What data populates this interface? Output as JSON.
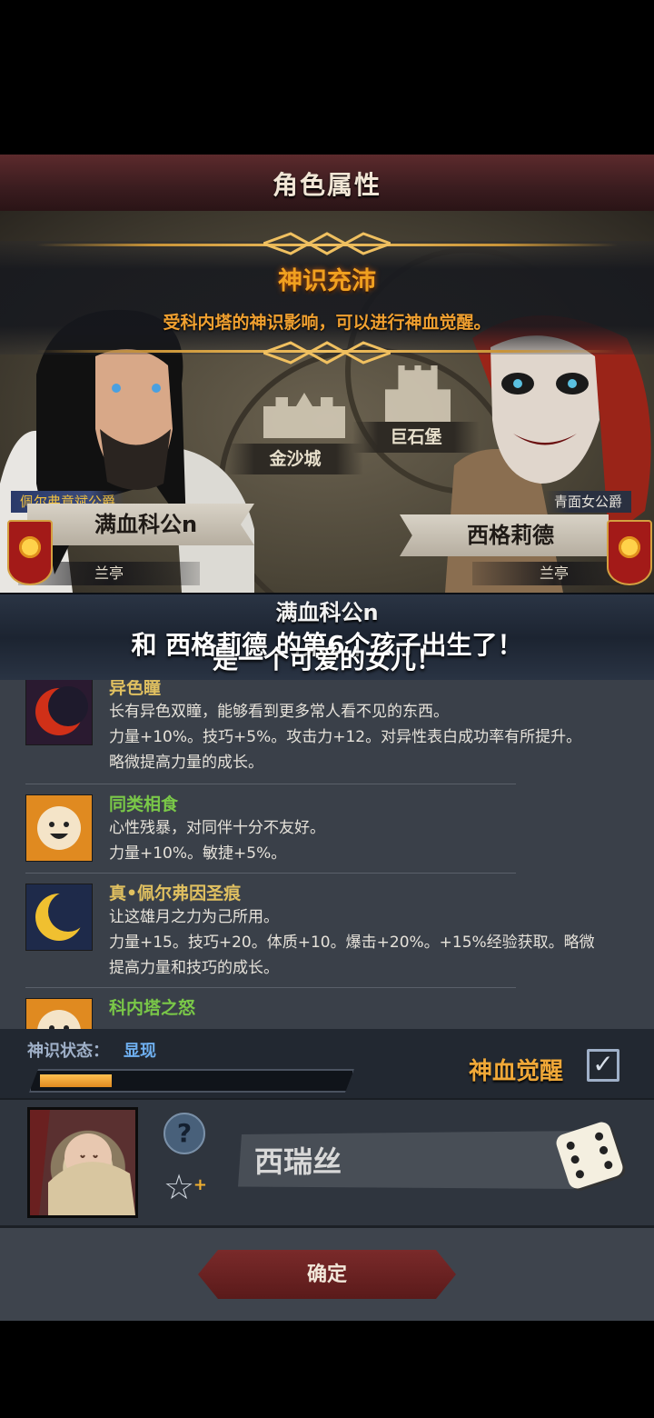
{
  "title": "角色属性",
  "banner": {
    "title": "神识充沛",
    "text": "受科内塔的神识影响，可以进行神血觉醒。"
  },
  "map": {
    "places": [
      "金沙城",
      "巨石堡"
    ]
  },
  "parents": {
    "left": {
      "title": "佩尔弗意斌公爵",
      "name": "满血科公n",
      "house": "兰亭"
    },
    "right": {
      "title": "青面女公爵",
      "name": "西格莉德",
      "house": "兰亭"
    }
  },
  "announcement": {
    "name": "满血科公n",
    "line1": "和 西格莉德 的第6个孩子出生了！",
    "line2": "是一个可爱的女儿！"
  },
  "traits": [
    {
      "name": "异色瞳",
      "name_color": "#e0c060",
      "icon": "red-crescent-icon",
      "desc": [
        "长有异色双瞳，能够看到更多常人看不见的东西。",
        "力量+10%。技巧+5%。攻击力+12。对异性表白成功率有所提升。",
        "略微提高力量的成长。"
      ]
    },
    {
      "name": "同类相食",
      "name_color": "#7ac848",
      "icon": "smiley-face-icon",
      "desc": [
        "心性残暴，对同伴十分不友好。",
        "力量+10%。敏捷+5%。"
      ]
    },
    {
      "name": "真•佩尔弗因圣痕",
      "name_color": "#e0c060",
      "icon": "gold-crescent-icon",
      "desc": [
        "让这雄月之力为己所用。",
        "力量+15。技巧+20。体质+10。爆击+20%。+15%经验获取。略微",
        "提高力量和技巧的成长。"
      ]
    },
    {
      "name": "科内塔之怒",
      "name_color": "#7ac848",
      "icon": "smiley-face-icon",
      "desc": []
    }
  ],
  "status": {
    "label": "神识状态：",
    "value": "显现",
    "progress": 0.24,
    "awaken_label": "神血觉醒",
    "awaken_checked": true
  },
  "child": {
    "name_value": "西瑞丝"
  },
  "confirm_label": "确定"
}
